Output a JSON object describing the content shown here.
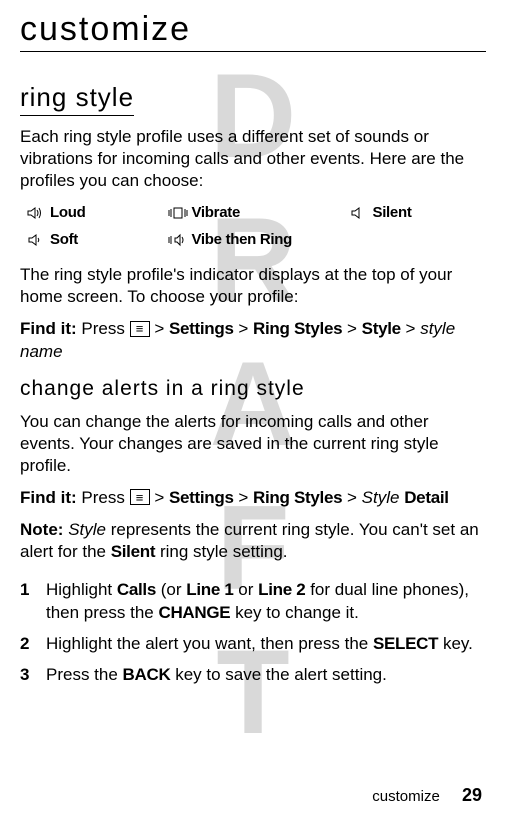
{
  "watermark": "DRAFT",
  "title": "customize",
  "section1": {
    "heading": "ring style",
    "intro": "Each ring style profile uses a different set of sounds or vibrations for incoming calls and other events. Here are the profiles you can choose:",
    "profiles": {
      "loud": "Loud",
      "vibrate": "Vibrate",
      "silent": "Silent",
      "soft": "Soft",
      "vibe_then_ring": "Vibe then Ring"
    },
    "after_profiles": "The ring style profile's indicator displays at the top of your home screen. To choose your profile:",
    "findit_label": "Find it:",
    "findit_press": "Press",
    "findit_path": {
      "p1": "Settings",
      "p2": "Ring Styles",
      "p3": "Style",
      "p4": "style name"
    }
  },
  "section2": {
    "heading": "change alerts in a ring style",
    "intro": "You can change the alerts for incoming calls and other events. Your changes are saved in the current ring style profile.",
    "findit_label": "Find it:",
    "findit_press": "Press",
    "findit_path": {
      "p1": "Settings",
      "p2": "Ring Styles",
      "p3_style": "Style",
      "p3_detail": "Detail"
    },
    "note_label": "Note:",
    "note_style": "Style",
    "note_text_after_style": " represents the current ring style. You can't set an alert for the ",
    "note_silent": "Silent",
    "note_text_end": " ring style setting.",
    "steps": {
      "s1": {
        "num": "1",
        "t1": "Highlight ",
        "calls": "Calls",
        "t2": "  (or ",
        "line1": "Line 1",
        "t3": " or ",
        "line2": "Line 2",
        "t4": " for dual line phones), then press the ",
        "change": "CHANGE",
        "t5": " key to change it."
      },
      "s2": {
        "num": "2",
        "t1": "Highlight the alert you want, then press the ",
        "select": "SELECT",
        "t2": " key."
      },
      "s3": {
        "num": "3",
        "t1": "Press the ",
        "back": "BACK",
        "t2": " key to save the alert setting."
      }
    }
  },
  "footer": {
    "label": "customize",
    "page": "29"
  }
}
